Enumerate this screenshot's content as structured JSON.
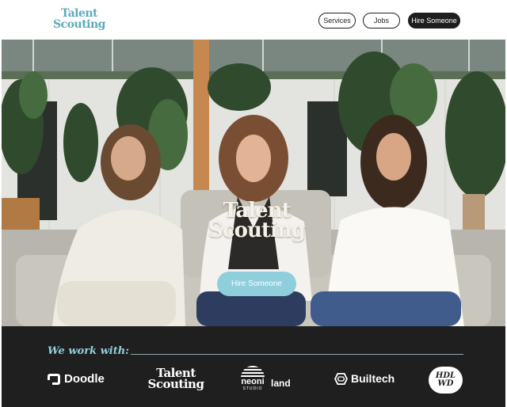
{
  "header": {
    "logo": {
      "line1": "Talent",
      "line2": "Scouting"
    },
    "nav": [
      {
        "label": "Services"
      },
      {
        "label": "Jobs"
      },
      {
        "label": "Hire Someone"
      }
    ]
  },
  "hero": {
    "logo": {
      "line1": "Talent",
      "line2": "Scouting"
    },
    "cta_label": "Hire Someone"
  },
  "partners": {
    "heading": "We work with:",
    "logos": {
      "doodle": "Doodle",
      "talent": {
        "line1": "Talent",
        "line2": "Scouting"
      },
      "neoni": {
        "name": "neoni",
        "sub": "STUDIO",
        "land": "land"
      },
      "builtech": "Builtech",
      "hdlwd": {
        "line1": "HDL",
        "line2": "WD"
      }
    }
  },
  "colors": {
    "accent": "#8fcfdc",
    "logo_blue": "#5ea9bd",
    "dark_band": "#1f1f1f",
    "nav_dark": "#1e1e1e"
  },
  "icons": [
    "doodle-mark-icon",
    "neoni-sun-icon",
    "builtech-hex-icon"
  ]
}
